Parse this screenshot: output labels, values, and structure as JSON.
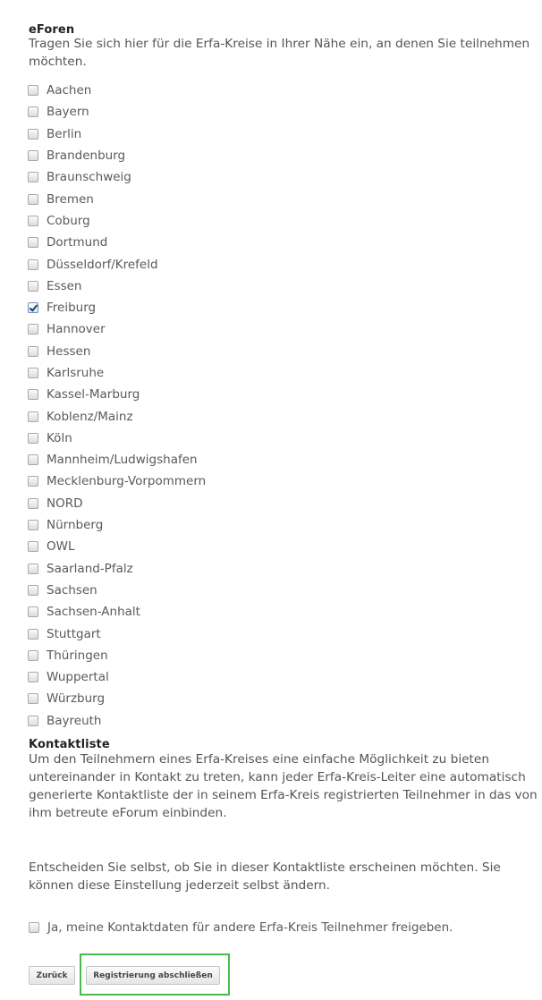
{
  "eforen": {
    "title": "eForen",
    "intro": "Tragen Sie sich hier für die Erfa-Kreise in Ihrer Nähe ein, an denen Sie teilnehmen möchten.",
    "items": [
      {
        "label": "Aachen",
        "checked": false
      },
      {
        "label": "Bayern",
        "checked": false
      },
      {
        "label": "Berlin",
        "checked": false
      },
      {
        "label": "Brandenburg",
        "checked": false
      },
      {
        "label": "Braunschweig",
        "checked": false
      },
      {
        "label": "Bremen",
        "checked": false
      },
      {
        "label": "Coburg",
        "checked": false
      },
      {
        "label": "Dortmund",
        "checked": false
      },
      {
        "label": "Düsseldorf/Krefeld",
        "checked": false
      },
      {
        "label": "Essen",
        "checked": false
      },
      {
        "label": "Freiburg",
        "checked": true
      },
      {
        "label": "Hannover",
        "checked": false
      },
      {
        "label": "Hessen",
        "checked": false
      },
      {
        "label": "Karlsruhe",
        "checked": false
      },
      {
        "label": "Kassel-Marburg",
        "checked": false
      },
      {
        "label": "Koblenz/Mainz",
        "checked": false
      },
      {
        "label": "Köln",
        "checked": false
      },
      {
        "label": "Mannheim/Ludwigshafen",
        "checked": false
      },
      {
        "label": "Mecklenburg-Vorpommern",
        "checked": false
      },
      {
        "label": "NORD",
        "checked": false
      },
      {
        "label": "Nürnberg",
        "checked": false
      },
      {
        "label": "OWL",
        "checked": false
      },
      {
        "label": "Saarland-Pfalz",
        "checked": false
      },
      {
        "label": "Sachsen",
        "checked": false
      },
      {
        "label": "Sachsen-Anhalt",
        "checked": false
      },
      {
        "label": "Stuttgart",
        "checked": false
      },
      {
        "label": "Thüringen",
        "checked": false
      },
      {
        "label": "Wuppertal",
        "checked": false
      },
      {
        "label": "Würzburg",
        "checked": false
      },
      {
        "label": "Bayreuth",
        "checked": false
      }
    ]
  },
  "kontaktliste": {
    "title": "Kontaktliste",
    "paragraph1": "Um den Teilnehmern eines Erfa-Kreises eine einfache Möglichkeit zu bieten untereinander in Kontakt zu treten, kann jeder Erfa-Kreis-Leiter eine automatisch generierte Kontaktliste der in seinem Erfa-Kreis registrierten Teilnehmer in das von ihm betreute eForum einbinden.",
    "paragraph2": "Entscheiden Sie selbst, ob Sie in dieser Kontaktliste erscheinen möchten. Sie können diese Einstellung jederzeit selbst ändern.",
    "consent": {
      "label": "Ja, meine Kontaktdaten für andere Erfa-Kreis Teilnehmer freigeben.",
      "checked": false
    }
  },
  "buttons": {
    "back": "Zurück",
    "submit": "Registrierung abschließen"
  },
  "colors": {
    "highlight": "#4cb94c",
    "checkmark": "#1d3f6d"
  }
}
